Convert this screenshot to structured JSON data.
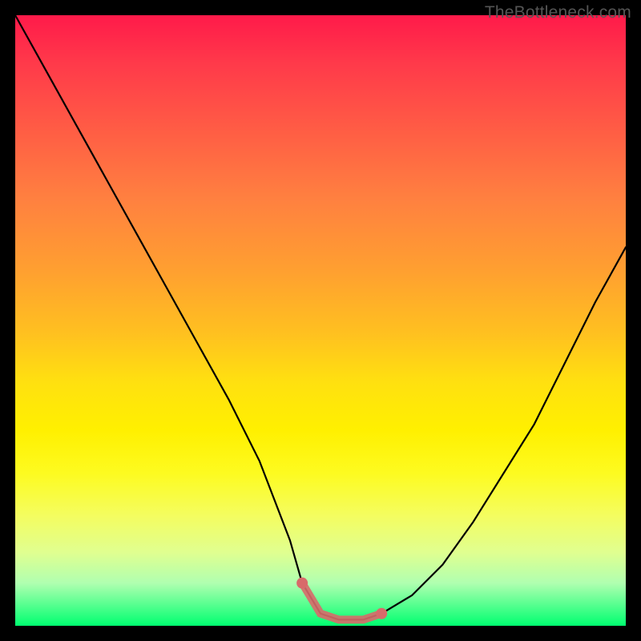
{
  "watermark": "TheBottleneck.com",
  "chart_data": {
    "type": "line",
    "title": "",
    "xlabel": "",
    "ylabel": "",
    "xlim": [
      0,
      100
    ],
    "ylim": [
      0,
      100
    ],
    "x": [
      0,
      5,
      10,
      15,
      20,
      25,
      30,
      35,
      40,
      45,
      47,
      50,
      53,
      55,
      57,
      60,
      65,
      70,
      75,
      80,
      85,
      90,
      95,
      100
    ],
    "values": [
      100,
      91,
      82,
      73,
      64,
      55,
      46,
      37,
      27,
      14,
      7,
      2,
      1,
      1,
      1,
      2,
      5,
      10,
      17,
      25,
      33,
      43,
      53,
      62
    ],
    "flat_zone": {
      "x_start": 47,
      "x_end": 60,
      "marker_color": "#d86a6a"
    },
    "grid": false,
    "legend": false
  }
}
